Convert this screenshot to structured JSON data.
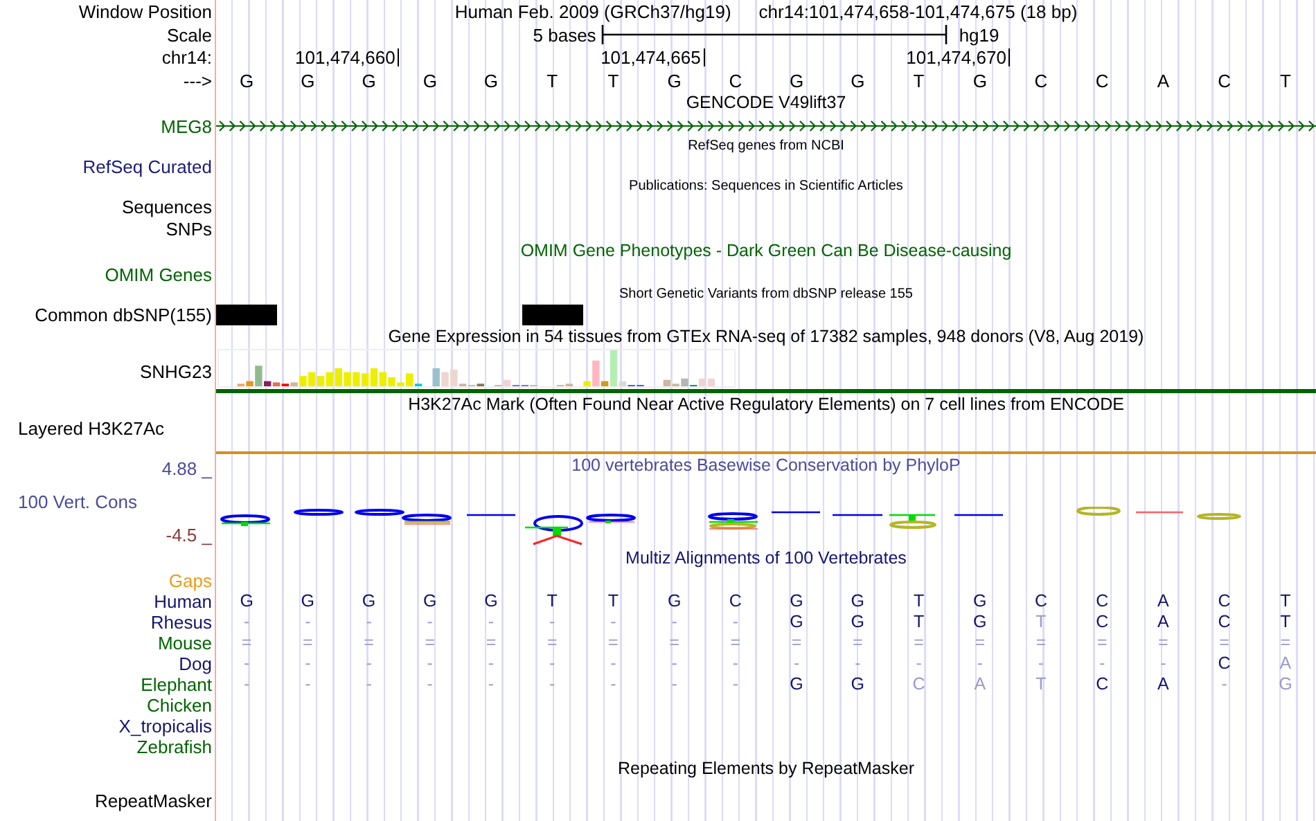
{
  "header": {
    "label": "Window Position",
    "assembly": "Human Feb. 2009 (GRCh37/hg19)",
    "position": "chr14:101,474,658-101,474,675 (18 bp)"
  },
  "scale": {
    "label": "Scale",
    "span": "5 bases",
    "db": "hg19"
  },
  "ruler": {
    "label": "chr14:",
    "ticks": [
      "101,474,660",
      "101,474,665",
      "101,474,670"
    ]
  },
  "sequence": {
    "label": "--->",
    "bases": [
      "G",
      "G",
      "G",
      "G",
      "G",
      "T",
      "T",
      "G",
      "C",
      "G",
      "G",
      "T",
      "G",
      "C",
      "C",
      "A",
      "C",
      "T"
    ]
  },
  "tracks": [
    {
      "kind": "gene",
      "title": {
        "text": "GENCODE V49lift37",
        "color": "#000000",
        "small": false
      },
      "labels": [
        {
          "text": "MEG8",
          "color": "#006400"
        }
      ]
    },
    {
      "kind": "empty",
      "title": {
        "text": "RefSeq genes from NCBI",
        "color": "#000000",
        "small": true
      },
      "labels": [
        {
          "text": "RefSeq Curated",
          "color": "#1c1c7c"
        }
      ]
    },
    {
      "kind": "empty",
      "title": {
        "text": "Publications: Sequences in Scientific Articles",
        "color": "#000000",
        "small": true
      },
      "labels": [
        {
          "text": "Sequences",
          "color": "#000000"
        },
        {
          "text": "SNPs",
          "color": "#000000"
        }
      ]
    },
    {
      "kind": "empty",
      "title": {
        "text": "OMIM Gene Phenotypes - Dark Green Can Be Disease-causing",
        "color": "#006400",
        "small": false
      },
      "labels": [
        {
          "text": "OMIM Genes",
          "color": "#006400"
        }
      ]
    },
    {
      "kind": "snp",
      "title": {
        "text": "Short Genetic Variants from dbSNP release 155",
        "color": "#000000",
        "small": true
      },
      "labels": [
        {
          "text": "Common dbSNP(155)",
          "color": "#000000"
        }
      ],
      "variants": [
        true,
        false,
        false,
        false,
        false,
        true,
        false,
        false,
        false,
        false,
        false,
        false,
        false,
        false,
        false,
        false,
        false,
        false
      ]
    },
    {
      "kind": "expression",
      "title": {
        "text": "Gene Expression in 54 tissues from GTEx RNA-seq of 17382 samples, 948 donors (V8, Aug 2019)",
        "color": "#000000",
        "small": false
      },
      "labels": [
        {
          "text": "SNHG23",
          "color": "#000000"
        }
      ]
    },
    {
      "kind": "layered",
      "title": {
        "text": "H3K27Ac Mark (Often Found Near Active Regulatory Elements) on 7 cell lines from ENCODE",
        "color": "#000000",
        "small": false
      },
      "labels": [
        {
          "text": "Layered H3K27Ac",
          "color": "#000000"
        }
      ]
    },
    {
      "kind": "wiggle",
      "title": {
        "text": "100 vertebrates Basewise Conservation by PhyloP",
        "color": "#4b4b9b",
        "small": false
      },
      "labels": [
        {
          "text": "100 Vert. Cons",
          "color": "#4b4b9b"
        }
      ],
      "axis": {
        "max": "4.88 _",
        "min": "-4.5 _"
      }
    },
    {
      "kind": "multiz",
      "title": {
        "text": "Multiz Alignments of 100 Vertebrates",
        "color": "#14146e",
        "small": false
      },
      "rows": [
        {
          "name": "Gaps",
          "color": "#ee9a1a",
          "cells": []
        },
        {
          "name": "Human",
          "color": "#14146e",
          "cells": [
            {
              "base": "G",
              "faded": false
            },
            {
              "base": "G",
              "faded": false
            },
            {
              "base": "G",
              "faded": false
            },
            {
              "base": "G",
              "faded": false
            },
            {
              "base": "G",
              "faded": false
            },
            {
              "base": "T",
              "faded": false
            },
            {
              "base": "T",
              "faded": false
            },
            {
              "base": "G",
              "faded": false
            },
            {
              "base": "C",
              "faded": false
            },
            {
              "base": "G",
              "faded": false
            },
            {
              "base": "G",
              "faded": false
            },
            {
              "base": "T",
              "faded": false
            },
            {
              "base": "G",
              "faded": false
            },
            {
              "base": "C",
              "faded": false
            },
            {
              "base": "C",
              "faded": false
            },
            {
              "base": "A",
              "faded": false
            },
            {
              "base": "C",
              "faded": false
            },
            {
              "base": "T",
              "faded": false
            }
          ]
        },
        {
          "name": "Rhesus",
          "color": "#14146e",
          "cells": [
            {
              "base": "-",
              "faded": true
            },
            {
              "base": "-",
              "faded": true
            },
            {
              "base": "-",
              "faded": true
            },
            {
              "base": "-",
              "faded": true
            },
            {
              "base": "-",
              "faded": true
            },
            {
              "base": "-",
              "faded": true
            },
            {
              "base": "-",
              "faded": true
            },
            {
              "base": "-",
              "faded": true
            },
            {
              "base": "-",
              "faded": true
            },
            {
              "base": "G",
              "faded": false
            },
            {
              "base": "G",
              "faded": false
            },
            {
              "base": "T",
              "faded": false
            },
            {
              "base": "G",
              "faded": false
            },
            {
              "base": "T",
              "faded": true
            },
            {
              "base": "C",
              "faded": false
            },
            {
              "base": "A",
              "faded": false
            },
            {
              "base": "C",
              "faded": false
            },
            {
              "base": "T",
              "faded": false
            }
          ]
        },
        {
          "name": "Mouse",
          "color": "#006400",
          "cells": [
            {
              "base": "=",
              "faded": true
            },
            {
              "base": "=",
              "faded": true
            },
            {
              "base": "=",
              "faded": true
            },
            {
              "base": "=",
              "faded": true
            },
            {
              "base": "=",
              "faded": true
            },
            {
              "base": "=",
              "faded": true
            },
            {
              "base": "=",
              "faded": true
            },
            {
              "base": "=",
              "faded": true
            },
            {
              "base": "=",
              "faded": true
            },
            {
              "base": "=",
              "faded": true
            },
            {
              "base": "=",
              "faded": true
            },
            {
              "base": "=",
              "faded": true
            },
            {
              "base": "=",
              "faded": true
            },
            {
              "base": "=",
              "faded": true
            },
            {
              "base": "=",
              "faded": true
            },
            {
              "base": "=",
              "faded": true
            },
            {
              "base": "=",
              "faded": true
            },
            {
              "base": "=",
              "faded": true
            }
          ]
        },
        {
          "name": "Dog",
          "color": "#14146e",
          "cells": [
            {
              "base": "-",
              "faded": true
            },
            {
              "base": "-",
              "faded": true
            },
            {
              "base": "-",
              "faded": true
            },
            {
              "base": "-",
              "faded": true
            },
            {
              "base": "-",
              "faded": true
            },
            {
              "base": "-",
              "faded": true
            },
            {
              "base": "-",
              "faded": true
            },
            {
              "base": "-",
              "faded": true
            },
            {
              "base": "-",
              "faded": true
            },
            {
              "base": "-",
              "faded": true
            },
            {
              "base": "-",
              "faded": true
            },
            {
              "base": "-",
              "faded": true
            },
            {
              "base": "-",
              "faded": true
            },
            {
              "base": "-",
              "faded": true
            },
            {
              "base": "-",
              "faded": true
            },
            {
              "base": "-",
              "faded": true
            },
            {
              "base": "C",
              "faded": false
            },
            {
              "base": "A",
              "faded": true
            }
          ]
        },
        {
          "name": "Elephant",
          "color": "#006400",
          "cells": [
            {
              "base": "-",
              "faded": true
            },
            {
              "base": "-",
              "faded": true
            },
            {
              "base": "-",
              "faded": true
            },
            {
              "base": "-",
              "faded": true
            },
            {
              "base": "-",
              "faded": true
            },
            {
              "base": "-",
              "faded": true
            },
            {
              "base": "-",
              "faded": true
            },
            {
              "base": "-",
              "faded": true
            },
            {
              "base": "-",
              "faded": true
            },
            {
              "base": "G",
              "faded": false
            },
            {
              "base": "G",
              "faded": false
            },
            {
              "base": "C",
              "faded": true
            },
            {
              "base": "A",
              "faded": true
            },
            {
              "base": "T",
              "faded": true
            },
            {
              "base": "C",
              "faded": false
            },
            {
              "base": "A",
              "faded": false
            },
            {
              "base": "-",
              "faded": true
            },
            {
              "base": "G",
              "faded": true
            }
          ]
        },
        {
          "name": "Chicken",
          "color": "#006400",
          "cells": []
        },
        {
          "name": "X_tropicalis",
          "color": "#14146e",
          "cells": []
        },
        {
          "name": "Zebrafish",
          "color": "#006400",
          "cells": []
        }
      ]
    },
    {
      "kind": "empty",
      "title": {
        "text": "Repeating Elements by RepeatMasker",
        "color": "#000000",
        "small": false
      },
      "labels": [
        {
          "text": "RepeatMasker",
          "color": "#000000"
        }
      ]
    }
  ]
}
